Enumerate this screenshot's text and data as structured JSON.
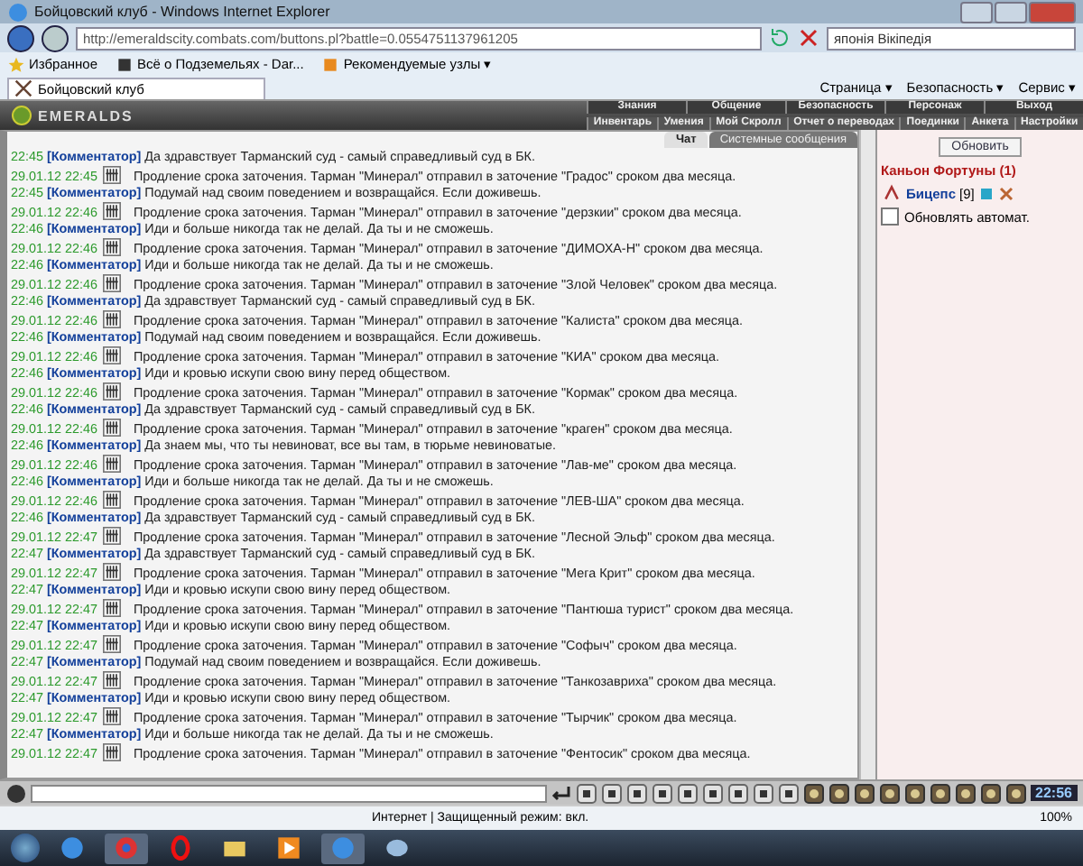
{
  "window": {
    "title": "Бойцовский клуб - Windows Internet Explorer"
  },
  "address_bar": {
    "url": "http://emeraldscity.combats.com/buttons.pl?battle=0.0554751137961205",
    "search": "японія Вікіпедія"
  },
  "favorites_bar": {
    "items": [
      "Избранное",
      "Всё о Подземельях - Dar...",
      "Рекомендуемые узлы ▾"
    ]
  },
  "browser_tab": {
    "title": "Бойцовский клуб"
  },
  "command_bar": {
    "items": [
      "Страница ▾",
      "Безопасность ▾",
      "Сервис ▾"
    ]
  },
  "game_header": {
    "logo": "EMERALDS",
    "top_menu": [
      "Знания",
      "Общение",
      "Безопасность",
      "Персонаж",
      "Выход"
    ],
    "sub_menu": [
      "Инвентарь",
      "Умения",
      "Мой Скролл",
      "Отчет о переводах",
      "Поединки",
      "Анкета",
      "Настройки"
    ]
  },
  "chat_tabs": [
    {
      "label": "Чат",
      "selected": true
    },
    {
      "label": "Системные сообщения",
      "selected": false
    }
  ],
  "chat": [
    {
      "kind": "comment",
      "time": "22:45",
      "author": "[Комментатор]",
      "text": "Да здравствует Тарманский суд - самый справедливый суд в БК."
    },
    {
      "kind": "system",
      "time": "29.01.12 22:45",
      "text": "Продление срока заточения. Тарман \"Минерал\" отправил в заточение \"Градос\" сроком два месяца."
    },
    {
      "kind": "comment",
      "time": "22:45",
      "author": "[Комментатор]",
      "text": "Подумай над своим поведением и возвращайся. Если доживешь."
    },
    {
      "kind": "system",
      "time": "29.01.12 22:46",
      "text": "Продление срока заточения. Тарман \"Минерал\" отправил в заточение \"дерзкии\" сроком два месяца."
    },
    {
      "kind": "comment",
      "time": "22:46",
      "author": "[Комментатор]",
      "text": "Иди и больше никогда так не делай. Да ты и не сможешь."
    },
    {
      "kind": "system",
      "time": "29.01.12 22:46",
      "text": "Продление срока заточения. Тарман \"Минерал\" отправил в заточение \"ДИМОХА-Н\" сроком два месяца."
    },
    {
      "kind": "comment",
      "time": "22:46",
      "author": "[Комментатор]",
      "text": "Иди и больше никогда так не делай. Да ты и не сможешь."
    },
    {
      "kind": "system",
      "time": "29.01.12 22:46",
      "text": "Продление срока заточения. Тарман \"Минерал\" отправил в заточение \"Злой Человек\" сроком два месяца."
    },
    {
      "kind": "comment",
      "time": "22:46",
      "author": "[Комментатор]",
      "text": "Да здравствует Тарманский суд - самый справедливый суд в БК."
    },
    {
      "kind": "system",
      "time": "29.01.12 22:46",
      "text": "Продление срока заточения. Тарман \"Минерал\" отправил в заточение \"Калиста\" сроком два месяца."
    },
    {
      "kind": "comment",
      "time": "22:46",
      "author": "[Комментатор]",
      "text": "Подумай над своим поведением и возвращайся. Если доживешь."
    },
    {
      "kind": "system",
      "time": "29.01.12 22:46",
      "text": "Продление срока заточения. Тарман \"Минерал\" отправил в заточение \"КИА\" сроком два месяца."
    },
    {
      "kind": "comment",
      "time": "22:46",
      "author": "[Комментатор]",
      "text": "Иди и кровью искупи свою вину перед обществом."
    },
    {
      "kind": "system",
      "time": "29.01.12 22:46",
      "text": "Продление срока заточения. Тарман \"Минерал\" отправил в заточение \"Кормак\" сроком два месяца."
    },
    {
      "kind": "comment",
      "time": "22:46",
      "author": "[Комментатор]",
      "text": "Да здравствует Тарманский суд - самый справедливый суд в БК."
    },
    {
      "kind": "system",
      "time": "29.01.12 22:46",
      "text": "Продление срока заточения. Тарман \"Минерал\" отправил в заточение \"краген\" сроком два месяца."
    },
    {
      "kind": "comment",
      "time": "22:46",
      "author": "[Комментатор]",
      "text": "Да знаем мы, что ты невиноват, все вы там, в тюрьме невиноватые."
    },
    {
      "kind": "system",
      "time": "29.01.12 22:46",
      "text": "Продление срока заточения. Тарман \"Минерал\" отправил в заточение \"Лав-ме\" сроком два месяца."
    },
    {
      "kind": "comment",
      "time": "22:46",
      "author": "[Комментатор]",
      "text": "Иди и больше никогда так не делай. Да ты и не сможешь."
    },
    {
      "kind": "system",
      "time": "29.01.12 22:46",
      "text": "Продление срока заточения. Тарман \"Минерал\" отправил в заточение \"ЛЕВ-ША\" сроком два месяца."
    },
    {
      "kind": "comment",
      "time": "22:46",
      "author": "[Комментатор]",
      "text": "Да здравствует Тарманский суд - самый справедливый суд в БК."
    },
    {
      "kind": "system",
      "time": "29.01.12 22:47",
      "text": "Продление срока заточения. Тарман \"Минерал\" отправил в заточение \"Лесной Эльф\" сроком два месяца."
    },
    {
      "kind": "comment",
      "time": "22:47",
      "author": "[Комментатор]",
      "text": "Да здравствует Тарманский суд - самый справедливый суд в БК."
    },
    {
      "kind": "system",
      "time": "29.01.12 22:47",
      "text": "Продление срока заточения. Тарман \"Минерал\" отправил в заточение \"Мега Крит\" сроком два месяца."
    },
    {
      "kind": "comment",
      "time": "22:47",
      "author": "[Комментатор]",
      "text": "Иди и кровью искупи свою вину перед обществом."
    },
    {
      "kind": "system",
      "time": "29.01.12 22:47",
      "text": "Продление срока заточения. Тарман \"Минерал\" отправил в заточение \"Пантюша турист\" сроком два месяца."
    },
    {
      "kind": "comment",
      "time": "22:47",
      "author": "[Комментатор]",
      "text": "Иди и кровью искупи свою вину перед обществом."
    },
    {
      "kind": "system",
      "time": "29.01.12 22:47",
      "text": "Продление срока заточения. Тарман \"Минерал\" отправил в заточение \"Софыч\" сроком два месяца."
    },
    {
      "kind": "comment",
      "time": "22:47",
      "author": "[Комментатор]",
      "text": "Подумай над своим поведением и возвращайся. Если доживешь."
    },
    {
      "kind": "system",
      "time": "29.01.12 22:47",
      "text": "Продление срока заточения. Тарман \"Минерал\" отправил в заточение \"Танкозавриха\" сроком два месяца."
    },
    {
      "kind": "comment",
      "time": "22:47",
      "author": "[Комментатор]",
      "text": "Иди и кровью искупи свою вину перед обществом."
    },
    {
      "kind": "system",
      "time": "29.01.12 22:47",
      "text": "Продление срока заточения. Тарман \"Минерал\" отправил в заточение \"Тырчик\" сроком два месяца."
    },
    {
      "kind": "comment",
      "time": "22:47",
      "author": "[Комментатор]",
      "text": "Иди и больше никогда так не делай. Да ты и не сможешь."
    },
    {
      "kind": "system",
      "time": "29.01.12 22:47",
      "text": "Продление срока заточения. Тарман \"Минерал\" отправил в заточение \"Фентосик\" сроком два месяца."
    }
  ],
  "side_panel": {
    "refresh_button": "Обновить",
    "location": "Каньон Фортуны (1)",
    "player": {
      "name": "Бицепс",
      "level": "[9]"
    },
    "auto_refresh": {
      "label": "Обновлять автомат.",
      "checked": false
    }
  },
  "game_clock": "22:56",
  "status_bar": {
    "zone": "Интернет | Защищенный режим: вкл.",
    "zoom": "100%"
  }
}
